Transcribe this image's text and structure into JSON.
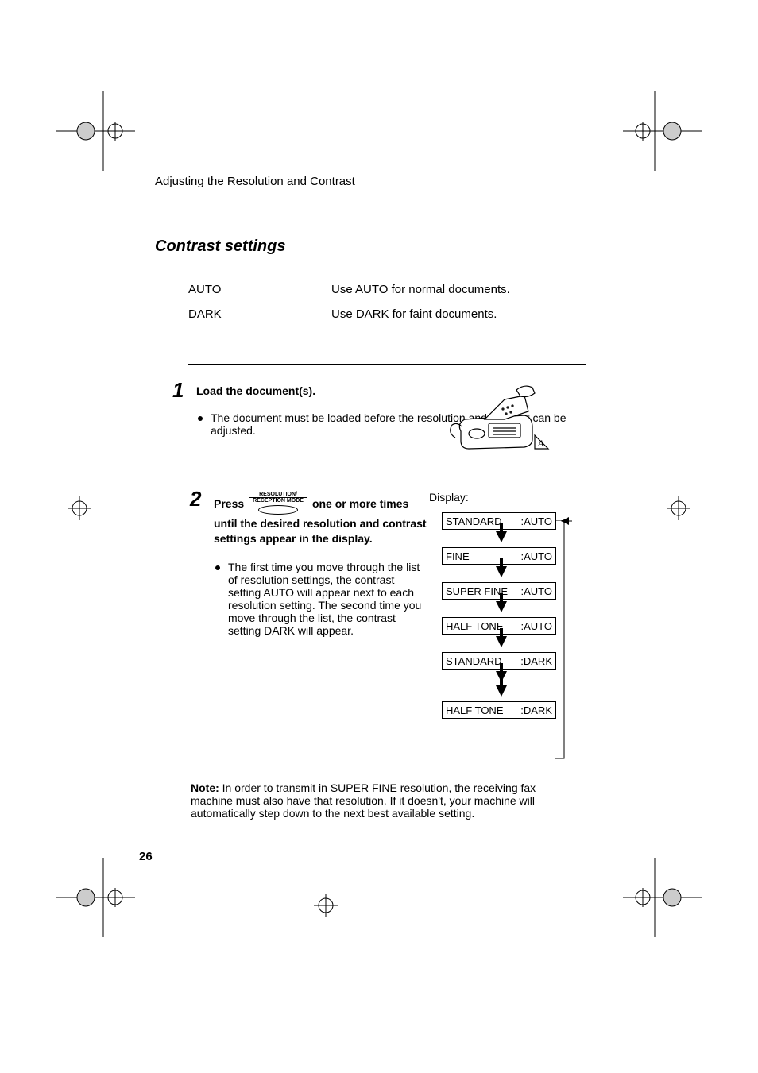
{
  "running_head": "Adjusting the Resolution and Contrast",
  "heading": "Contrast settings",
  "table": {
    "rows": [
      {
        "label": "AUTO",
        "desc": "Use AUTO for normal documents."
      },
      {
        "label": "DARK",
        "desc": "Use DARK for faint documents."
      }
    ]
  },
  "step1": {
    "num": "1",
    "title": "Load the document(s).",
    "bullet": "The document must be loaded before the resolution and contrast can be adjusted."
  },
  "step2": {
    "num": "2",
    "prefix": "Press ",
    "key_top": "RESOLUTION/",
    "key_bot": "RECEPTION MODE",
    "suffix": " one or more times until the desired resolution and contrast settings appear in the display.",
    "bullet": "The first time you move through the list of resolution settings, the contrast setting AUTO will appear next to each resolution setting. The second time you move through the list, the contrast setting DARK will appear."
  },
  "display_label": "Display:",
  "lcd_sequence": [
    {
      "left": "STANDARD",
      "right": ":AUTO"
    },
    {
      "left": "FINE",
      "right": ":AUTO"
    },
    {
      "left": "SUPER FINE",
      "right": ":AUTO"
    },
    {
      "left": "HALF TONE",
      "right": ":AUTO"
    },
    {
      "left": "STANDARD",
      "right": ":DARK"
    },
    {
      "left": "HALF TONE",
      "right": ":DARK"
    }
  ],
  "note": {
    "prefix": "Note: ",
    "body": "In order to transmit in SUPER FINE resolution, the receiving fax machine must also have that resolution. If it doesn't, your machine will automatically step down to the next best available setting."
  },
  "page_num": "26"
}
